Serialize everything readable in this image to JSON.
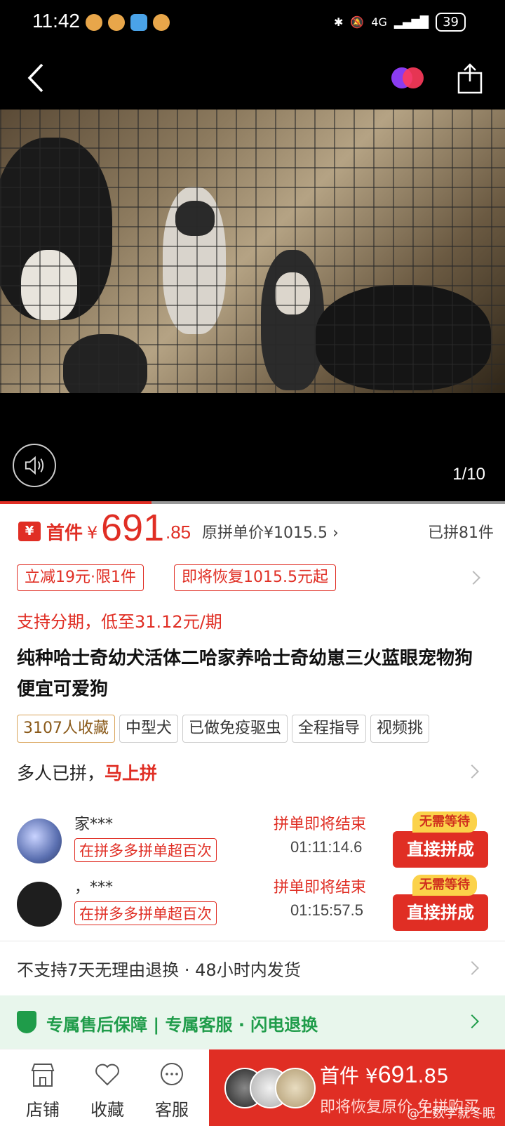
{
  "status_bar": {
    "time": "11:42",
    "network": "4G",
    "battery": "39"
  },
  "media": {
    "page_counter": "1/10",
    "progress_fraction": 0.3
  },
  "price": {
    "first_label": "首件",
    "yen": "¥",
    "integer": "691",
    "decimal": ".85",
    "original_price": "原拼单价¥1015.5",
    "sold": "已拼81件"
  },
  "promos": [
    "立减19元·限1件",
    "即将恢复1015.5元起"
  ],
  "installment": "支持分期，低至31.12元/期",
  "product_title": "纯种哈士奇幼犬活体二哈家养哈士奇幼崽三火蓝眼宠物狗便宜可爱狗",
  "tags": [
    "3107人收藏",
    "中型犬",
    "已做免疫驱虫",
    "全程指导",
    "视频挑"
  ],
  "group_section": {
    "label": "多人已拼，",
    "cta": "马上拼",
    "groups": [
      {
        "name": "家***",
        "badge": "在拼多多拼单超百次",
        "ending": "拼单即将结束",
        "countdown": "01:11:14.6",
        "button": "直接拼成",
        "no_wait": "无需等待"
      },
      {
        "name": "，***",
        "badge": "在拼多多拼单超百次",
        "ending": "拼单即将结束",
        "countdown": "01:15:57.5",
        "button": "直接拼成",
        "no_wait": "无需等待"
      }
    ]
  },
  "policy": "不支持7天无理由退换 · 48小时内发货",
  "guarantee": "专属售后保障 | 专属客服 · 闪电退换",
  "bottom_bar": {
    "store": "店铺",
    "favorite": "收藏",
    "service": "客服",
    "buy_title": "首件",
    "buy_yen": "¥",
    "buy_price_int": "691",
    "buy_price_dec": ".85",
    "buy_sub": "即将恢复原价 免拼购买"
  },
  "watermark": "@上数学就冬眠",
  "colors": {
    "accent": "#e02e24",
    "guarantee": "#1f9c4a"
  }
}
